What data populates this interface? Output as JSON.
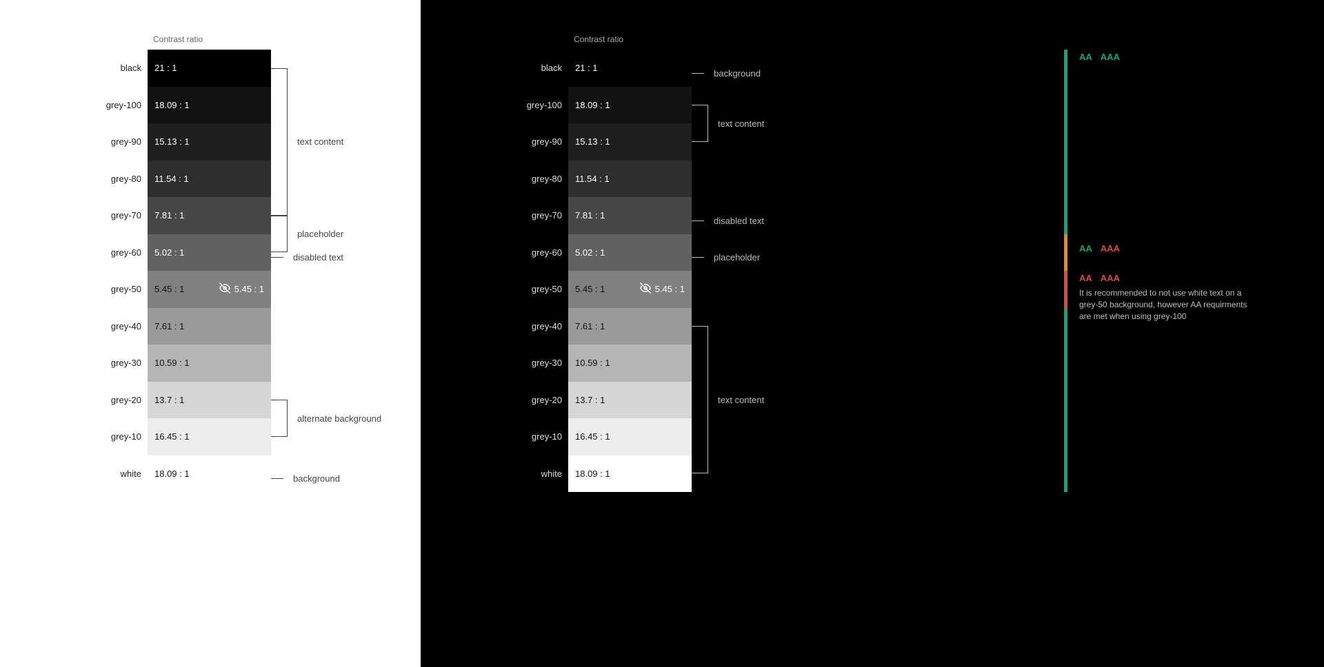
{
  "header_label": "Contrast ratio",
  "swatches": [
    {
      "name": "black",
      "ratio": "21 : 1",
      "bg": "#000000",
      "fg": "#ffffff"
    },
    {
      "name": "grey-100",
      "ratio": "18.09 : 1",
      "bg": "#121212",
      "fg": "#ffffff"
    },
    {
      "name": "grey-90",
      "ratio": "15.13 : 1",
      "bg": "#1f1f1f",
      "fg": "#ffffff"
    },
    {
      "name": "grey-80",
      "ratio": "11.54 : 1",
      "bg": "#2e2e2e",
      "fg": "#ffffff"
    },
    {
      "name": "grey-70",
      "ratio": "7.81 : 1",
      "bg": "#474747",
      "fg": "#ffffff"
    },
    {
      "name": "grey-60",
      "ratio": "5.02 : 1",
      "bg": "#616161",
      "fg": "#ffffff"
    },
    {
      "name": "grey-50",
      "ratio": "5.45 : 1",
      "bg": "#808080",
      "fg": "#121212",
      "alt_ratio": "5.45 : 1"
    },
    {
      "name": "grey-40",
      "ratio": "7.61 : 1",
      "bg": "#9a9a9a",
      "fg": "#121212"
    },
    {
      "name": "grey-30",
      "ratio": "10.59 : 1",
      "bg": "#b5b5b5",
      "fg": "#121212"
    },
    {
      "name": "grey-20",
      "ratio": "13.7 : 1",
      "bg": "#d6d6d6",
      "fg": "#121212"
    },
    {
      "name": "grey-10",
      "ratio": "16.45 : 1",
      "bg": "#ededed",
      "fg": "#121212"
    },
    {
      "name": "white",
      "ratio": "18.09 : 1",
      "bg": "#ffffff",
      "fg": "#121212"
    }
  ],
  "light_brackets": [
    {
      "label": "text content",
      "from": 0,
      "to": 4,
      "type": "range"
    },
    {
      "label": "placeholder",
      "from": 4,
      "to": 5,
      "type": "range"
    },
    {
      "label": "disabled text",
      "from": 5,
      "to": 5,
      "type": "dash"
    },
    {
      "label": "alternate background",
      "from": 9,
      "to": 10,
      "type": "range"
    },
    {
      "label": "background",
      "from": 11,
      "to": 11,
      "type": "dash"
    }
  ],
  "dark_brackets": [
    {
      "label": "background",
      "from": 0,
      "to": 0,
      "type": "dash"
    },
    {
      "label": "text content",
      "from": 1,
      "to": 2,
      "type": "range"
    },
    {
      "label": "disabled text",
      "from": 4,
      "to": 4,
      "type": "dash"
    },
    {
      "label": "placeholder",
      "from": 5,
      "to": 5,
      "type": "dash"
    },
    {
      "label": "text content",
      "from": 7,
      "to": 11,
      "type": "range"
    }
  ],
  "legend": {
    "segments": [
      {
        "color_class": "bar-green1",
        "from": 0,
        "to": 5
      },
      {
        "color_class": "bar-orange",
        "from": 5,
        "to": 6
      },
      {
        "color_class": "bar-red",
        "from": 6,
        "to": 7
      },
      {
        "color_class": "bar-green2",
        "from": 7,
        "to": 12
      }
    ],
    "items": [
      {
        "row": 0.2,
        "aa_class": "green-text",
        "aaa_class": "green-text",
        "aa": "AA",
        "aaa": "AAA"
      },
      {
        "row": 5.4,
        "aa_class": "green-text",
        "aaa_class": "red-text",
        "aa": "AA",
        "aaa": "AAA"
      },
      {
        "row": 6.2,
        "aa_class": "red-text",
        "aaa_class": "red-text",
        "aa": "AA",
        "aaa": "AAA",
        "note": "It is recommended to not use white text on a grey-50 background, however AA requirments are met when using grey-100"
      }
    ]
  }
}
